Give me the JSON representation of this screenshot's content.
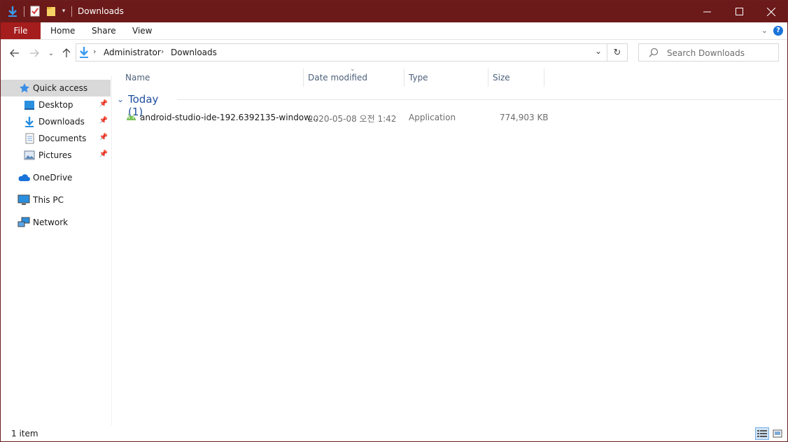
{
  "window": {
    "title": "Downloads"
  },
  "ribbon": {
    "tabs": [
      "File",
      "Home",
      "Share",
      "View"
    ]
  },
  "nav": {
    "breadcrumbs": [
      "Administrator",
      "Downloads"
    ],
    "search_placeholder": "Search Downloads"
  },
  "sidebar": {
    "items": [
      {
        "label": "Quick access",
        "icon": "star-icon",
        "selected": true,
        "pinned": false
      },
      {
        "label": "Desktop",
        "icon": "desktop-icon",
        "pinned": true
      },
      {
        "label": "Downloads",
        "icon": "download-arrow-icon",
        "pinned": true
      },
      {
        "label": "Documents",
        "icon": "document-icon",
        "pinned": true
      },
      {
        "label": "Pictures",
        "icon": "pictures-icon",
        "pinned": true
      },
      {
        "label": "OneDrive",
        "icon": "cloud-icon"
      },
      {
        "label": "This PC",
        "icon": "computer-icon"
      },
      {
        "label": "Network",
        "icon": "network-icon"
      }
    ]
  },
  "columns": [
    "Name",
    "Date modified",
    "Type",
    "Size"
  ],
  "group": {
    "label": "Today (1)"
  },
  "files": [
    {
      "name": "android-studio-ide-192.6392135-window...",
      "date": "2020-05-08 오전 1:42",
      "type": "Application",
      "size": "774,903 KB"
    }
  ],
  "status": {
    "count": "1 item"
  },
  "colors": {
    "titlebar": "#6b1919",
    "file_tab": "#a61d1d",
    "accent": "#1e4e9e"
  }
}
